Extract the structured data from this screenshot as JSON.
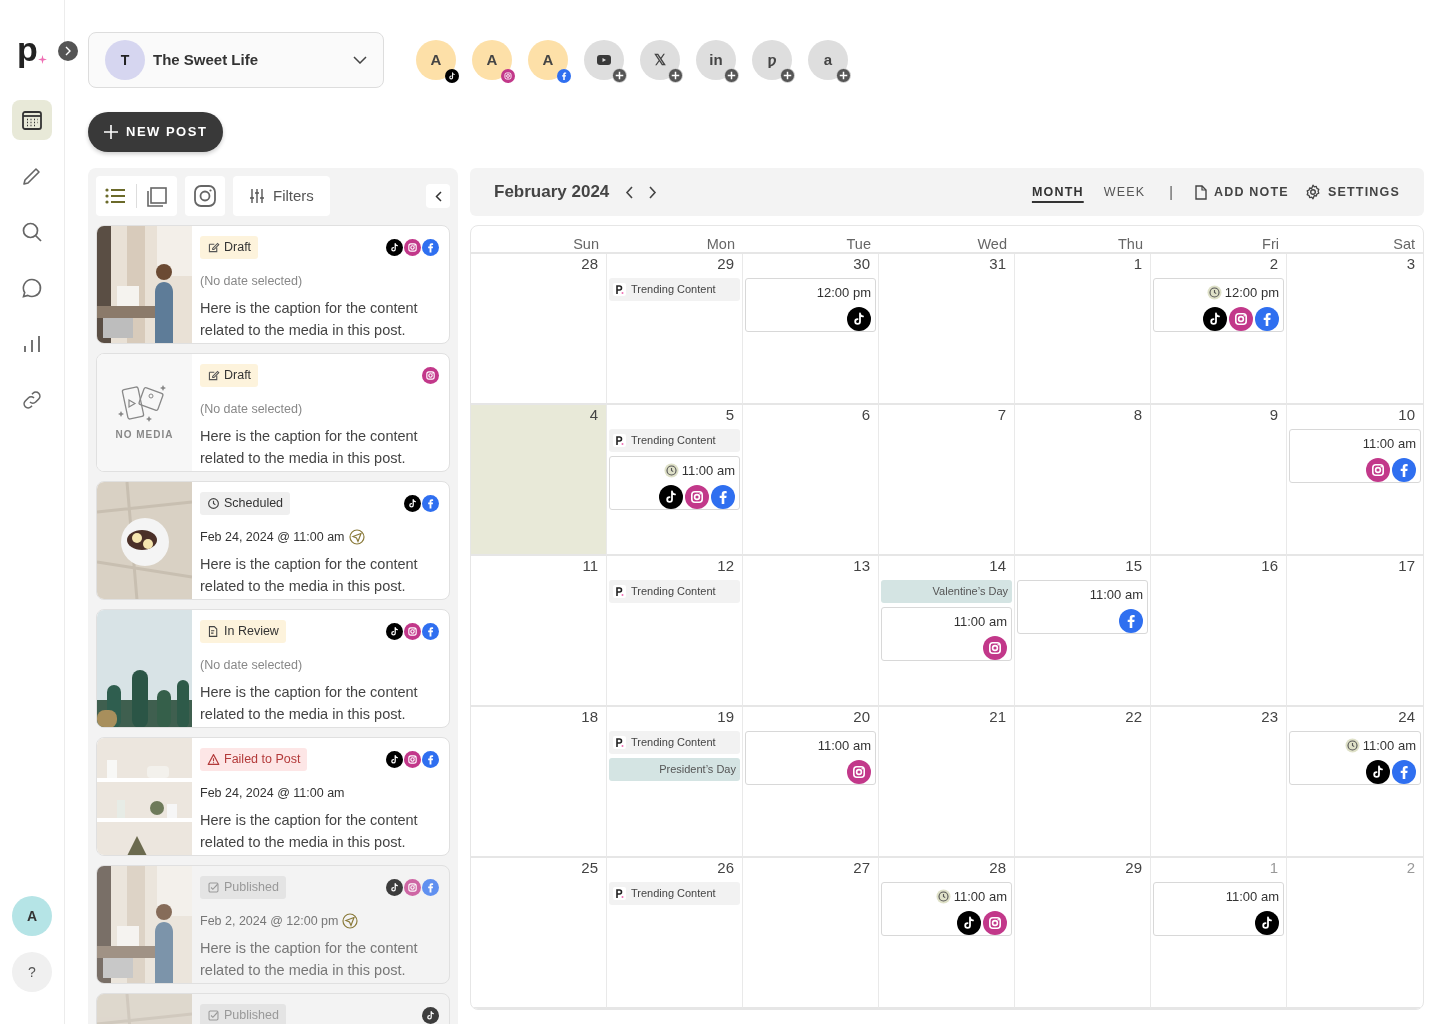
{
  "brand": {
    "logo": "p"
  },
  "nav": {
    "items": [
      {
        "kind": "calendar",
        "selected": true
      },
      {
        "kind": "compose",
        "selected": false
      },
      {
        "kind": "search",
        "selected": false
      },
      {
        "kind": "messages",
        "selected": false
      },
      {
        "kind": "analytics",
        "selected": false
      },
      {
        "kind": "links",
        "selected": false
      }
    ],
    "account": "A",
    "help": "?"
  },
  "profile": {
    "initial": "T",
    "name": "The Sweet Life"
  },
  "channels": [
    {
      "kind": "tiktok",
      "connected": true,
      "initial": "A"
    },
    {
      "kind": "instagram",
      "connected": true,
      "initial": "A"
    },
    {
      "kind": "facebook",
      "connected": true,
      "initial": "A"
    },
    {
      "kind": "youtube",
      "connected": false
    },
    {
      "kind": "x",
      "connected": false,
      "glyph": "𝕏"
    },
    {
      "kind": "linkedin",
      "connected": false,
      "glyph": "in"
    },
    {
      "kind": "pinterest",
      "connected": false,
      "glyph": "ƿ"
    },
    {
      "kind": "amazon",
      "connected": false,
      "glyph": "a"
    }
  ],
  "new_post": "NEW POST",
  "toolbar": {
    "views": [
      {
        "kind": "list",
        "selected": true
      },
      {
        "kind": "grid",
        "selected": false
      }
    ],
    "filters": "Filters"
  },
  "posts": [
    {
      "media": {
        "kind": "picture"
      },
      "status": {
        "kind": "draft",
        "label": "Draft"
      },
      "networks": [
        {
          "kind": "tiktok"
        },
        {
          "kind": "instagram"
        },
        {
          "kind": "facebook"
        }
      ],
      "date": "(No date selected)",
      "has_date": false,
      "sent": false,
      "caption": "Here is the caption for the content related to the media in this post."
    },
    {
      "media": {
        "kind": "none",
        "label": "NO MEDIA"
      },
      "status": {
        "kind": "draft",
        "label": "Draft"
      },
      "networks": [
        {
          "kind": "instagram"
        }
      ],
      "date": "(No date selected)",
      "has_date": false,
      "sent": false,
      "caption": "Here is the caption for the content related to the media in this post."
    },
    {
      "media": {
        "kind": "picture"
      },
      "status": {
        "kind": "scheduled",
        "label": "Scheduled"
      },
      "networks": [
        {
          "kind": "tiktok"
        },
        {
          "kind": "facebook"
        }
      ],
      "date": "Feb 24, 2024 @ 11:00 am",
      "has_date": true,
      "sent": true,
      "caption": "Here is the caption for the content related to the media in this post."
    },
    {
      "media": {
        "kind": "picture"
      },
      "status": {
        "kind": "review",
        "label": "In Review"
      },
      "networks": [
        {
          "kind": "tiktok"
        },
        {
          "kind": "instagram"
        },
        {
          "kind": "facebook"
        }
      ],
      "date": "(No date selected)",
      "has_date": false,
      "sent": false,
      "caption": "Here is the caption for the content related to the media in this post."
    },
    {
      "media": {
        "kind": "picture"
      },
      "status": {
        "kind": "failed",
        "label": "Failed to Post"
      },
      "networks": [
        {
          "kind": "tiktok"
        },
        {
          "kind": "instagram"
        },
        {
          "kind": "facebook"
        }
      ],
      "date": "Feb 24, 2024 @ 11:00 am",
      "has_date": true,
      "sent": false,
      "caption": "Here is the caption for the content related to the media in this post."
    },
    {
      "media": {
        "kind": "picture"
      },
      "status": {
        "kind": "published",
        "label": "Published"
      },
      "networks": [
        {
          "kind": "tiktok"
        },
        {
          "kind": "instagram"
        },
        {
          "kind": "facebook"
        }
      ],
      "date": "Feb 2, 2024 @ 12:00 pm",
      "has_date": true,
      "sent": true,
      "caption": "Here is the caption for the content related to the media in this post."
    },
    {
      "media": {
        "kind": "picture"
      },
      "status": {
        "kind": "published",
        "label": "Published"
      },
      "networks": [
        {
          "kind": "tiktok"
        }
      ]
    }
  ],
  "calendar": {
    "title": "February 2024",
    "views": [
      {
        "label": "MONTH",
        "selected": true
      },
      {
        "label": "WEEK",
        "selected": false
      }
    ],
    "separator": "|",
    "add_note": "ADD NOTE",
    "settings": "SETTINGS",
    "weekdays": [
      "Sun",
      "Mon",
      "Tue",
      "Wed",
      "Thu",
      "Fri",
      "Sat"
    ],
    "weeks": [
      [
        {
          "day": "28",
          "today": false,
          "outside": false
        },
        {
          "day": "29",
          "today": false,
          "outside": false,
          "events": [
            {
              "kind": "trend",
              "label": "Trending Content"
            }
          ]
        },
        {
          "day": "30",
          "today": false,
          "outside": false,
          "events": [
            {
              "kind": "post",
              "time": "12:00 pm",
              "scheduled": false,
              "networks": [
                {
                  "kind": "tiktok"
                }
              ]
            }
          ]
        },
        {
          "day": "31",
          "today": false,
          "outside": false
        },
        {
          "day": "1",
          "today": false,
          "outside": false
        },
        {
          "day": "2",
          "today": false,
          "outside": false,
          "events": [
            {
              "kind": "post",
              "time": "12:00 pm",
              "scheduled": true,
              "networks": [
                {
                  "kind": "tiktok"
                },
                {
                  "kind": "instagram"
                },
                {
                  "kind": "facebook"
                }
              ]
            }
          ]
        },
        {
          "day": "3",
          "today": false,
          "outside": false
        }
      ],
      [
        {
          "day": "4",
          "today": true,
          "outside": false
        },
        {
          "day": "5",
          "today": false,
          "outside": false,
          "events": [
            {
              "kind": "trend",
              "label": "Trending Content"
            },
            {
              "kind": "post",
              "time": "11:00 am",
              "scheduled": true,
              "networks": [
                {
                  "kind": "tiktok"
                },
                {
                  "kind": "instagram"
                },
                {
                  "kind": "facebook"
                }
              ]
            }
          ]
        },
        {
          "day": "6",
          "today": false,
          "outside": false
        },
        {
          "day": "7",
          "today": false,
          "outside": false
        },
        {
          "day": "8",
          "today": false,
          "outside": false
        },
        {
          "day": "9",
          "today": false,
          "outside": false
        },
        {
          "day": "10",
          "today": false,
          "outside": false,
          "events": [
            {
              "kind": "post",
              "time": "11:00 am",
              "scheduled": false,
              "networks": [
                {
                  "kind": "instagram"
                },
                {
                  "kind": "facebook"
                }
              ]
            }
          ]
        }
      ],
      [
        {
          "day": "11",
          "today": false,
          "outside": false
        },
        {
          "day": "12",
          "today": false,
          "outside": false,
          "events": [
            {
              "kind": "trend",
              "label": "Trending Content"
            }
          ]
        },
        {
          "day": "13",
          "today": false,
          "outside": false
        },
        {
          "day": "14",
          "today": false,
          "outside": false,
          "events": [
            {
              "kind": "holiday",
              "label": "Valentine’s Day"
            },
            {
              "kind": "post",
              "time": "11:00 am",
              "scheduled": false,
              "networks": [
                {
                  "kind": "instagram"
                }
              ]
            }
          ]
        },
        {
          "day": "15",
          "today": false,
          "outside": false,
          "events": [
            {
              "kind": "post",
              "time": "11:00 am",
              "scheduled": false,
              "networks": [
                {
                  "kind": "facebook"
                }
              ]
            }
          ]
        },
        {
          "day": "16",
          "today": false,
          "outside": false
        },
        {
          "day": "17",
          "today": false,
          "outside": false
        }
      ],
      [
        {
          "day": "18",
          "today": false,
          "outside": false
        },
        {
          "day": "19",
          "today": false,
          "outside": false,
          "events": [
            {
              "kind": "trend",
              "label": "Trending Content"
            },
            {
              "kind": "holiday",
              "label": "President’s Day"
            }
          ]
        },
        {
          "day": "20",
          "today": false,
          "outside": false,
          "events": [
            {
              "kind": "post",
              "time": "11:00 am",
              "scheduled": false,
              "networks": [
                {
                  "kind": "instagram"
                }
              ]
            }
          ]
        },
        {
          "day": "21",
          "today": false,
          "outside": false
        },
        {
          "day": "22",
          "today": false,
          "outside": false
        },
        {
          "day": "23",
          "today": false,
          "outside": false
        },
        {
          "day": "24",
          "today": false,
          "outside": false,
          "events": [
            {
              "kind": "post",
              "time": "11:00 am",
              "scheduled": true,
              "networks": [
                {
                  "kind": "tiktok"
                },
                {
                  "kind": "facebook"
                }
              ]
            }
          ]
        }
      ],
      [
        {
          "day": "25",
          "today": false,
          "outside": false
        },
        {
          "day": "26",
          "today": false,
          "outside": false,
          "events": [
            {
              "kind": "trend",
              "label": "Trending Content"
            }
          ]
        },
        {
          "day": "27",
          "today": false,
          "outside": false
        },
        {
          "day": "28",
          "today": false,
          "outside": false,
          "events": [
            {
              "kind": "post",
              "time": "11:00 am",
              "scheduled": true,
              "networks": [
                {
                  "kind": "tiktok"
                },
                {
                  "kind": "instagram"
                }
              ]
            }
          ]
        },
        {
          "day": "29",
          "today": false,
          "outside": false
        },
        {
          "day": "1",
          "today": false,
          "outside": true,
          "events": [
            {
              "kind": "post",
              "time": "11:00 am",
              "scheduled": false,
              "networks": [
                {
                  "kind": "tiktok"
                }
              ]
            }
          ]
        },
        {
          "day": "2",
          "today": false,
          "outside": true
        }
      ]
    ]
  }
}
